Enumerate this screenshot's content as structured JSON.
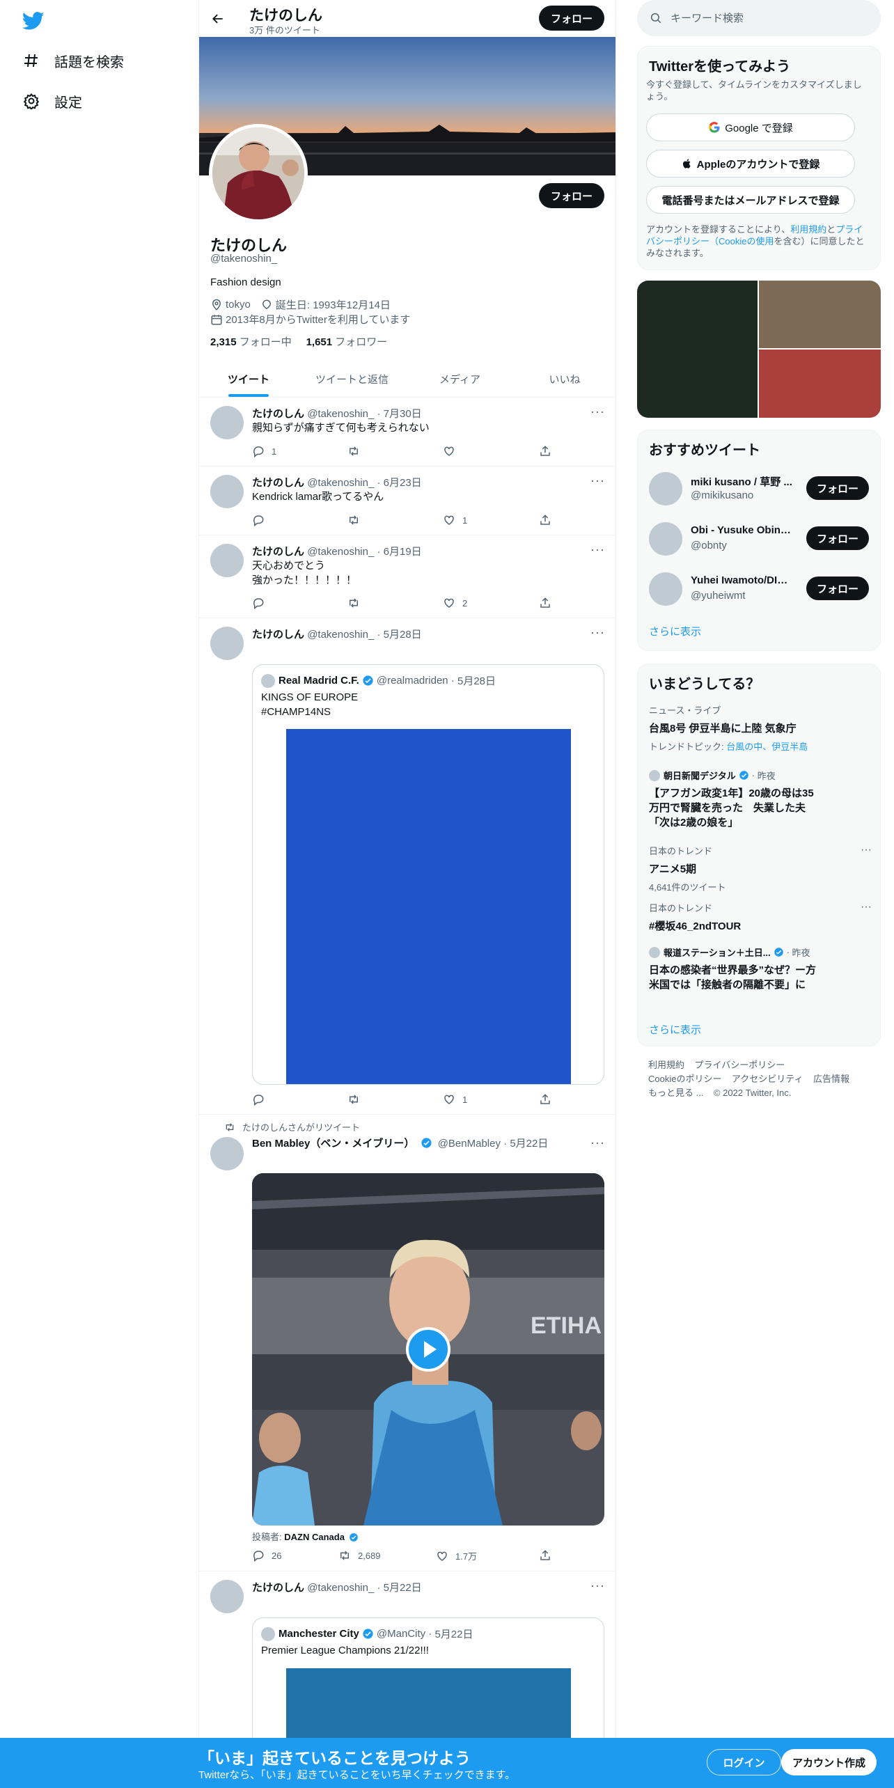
{
  "nav": {
    "items": [
      {
        "label": "話題を検索",
        "icon": "hashtag-icon"
      },
      {
        "label": "設定",
        "icon": "gear-icon"
      }
    ]
  },
  "header": {
    "name": "たけのしん",
    "tweet_count": "3万 件のツイート",
    "follow_label": "フォロー"
  },
  "profile": {
    "name": "たけのしん",
    "handle": "@takenoshin_",
    "bio": "Fashion design",
    "location": "tokyo",
    "birthday": "誕生日: 1993年12月14日",
    "joined": "2013年8月からTwitterを利用しています",
    "following_count": "2,315",
    "following_label": "フォロー中",
    "followers_count": "1,651",
    "followers_label": "フォロワー",
    "follow_label": "フォロー"
  },
  "tabs": [
    {
      "label": "ツイート",
      "active": true
    },
    {
      "label": "ツイートと返信",
      "active": false
    },
    {
      "label": "メディア",
      "active": false
    },
    {
      "label": "いいね",
      "active": false
    }
  ],
  "tweets": [
    {
      "name": "たけのしん",
      "handle": "@takenoshin_",
      "date": "7月30日",
      "text": "親知らずが痛すぎて何も考えられない",
      "replies": "1",
      "retweets": "",
      "likes": ""
    },
    {
      "name": "たけのしん",
      "handle": "@takenoshin_",
      "date": "6月23日",
      "text": "Kendrick lamar歌ってるやん",
      "replies": "",
      "retweets": "",
      "likes": "1"
    },
    {
      "name": "たけのしん",
      "handle": "@takenoshin_",
      "date": "6月19日",
      "text": "天心おめでとう\n強かった！！！！！！",
      "replies": "",
      "retweets": "",
      "likes": "2"
    },
    {
      "name": "たけのしん",
      "handle": "@takenoshin_",
      "date": "5月28日",
      "replies": "",
      "retweets": "",
      "likes": "1",
      "quote": {
        "name": "Real Madrid C.F.",
        "handle": "@realmadriden",
        "date": "5月28日",
        "text": "    KINGS OF EUROPE\n#CHAMP14NS"
      }
    },
    {
      "retweet_label": "たけのしんさんがリツイート",
      "name": "Ben Mabley（ベン・メイブリー）",
      "handle": "@BenMabley",
      "date": "5月22日",
      "source_prefix": "投稿者:",
      "source_name": "DAZN Canada",
      "replies": "26",
      "retweets": "2,689",
      "likes": "1.7万"
    },
    {
      "name": "たけのしん",
      "handle": "@takenoshin_",
      "date": "5月22日",
      "quote": {
        "name": "Manchester City",
        "handle": "@ManCity",
        "date": "5月22日",
        "text": "Premier League Champions 21/22!!!"
      }
    }
  ],
  "search": {
    "placeholder": "キーワード検索"
  },
  "signup_card": {
    "title": "Twitterを使ってみよう",
    "subtitle": "今すぐ登録して、タイムラインをカスタマイズしましょう。",
    "google": "Google で登録",
    "apple": "Appleのアカウントで登録",
    "phone": "電話番号またはメールアドレスで登録",
    "legal_1": "アカウントを登録することにより、",
    "legal_terms": "利用規約",
    "legal_2": "と",
    "legal_privacy": "プライバシーポリシー（Cookieの使用",
    "legal_3": "を含む）に同意したとみなされます。"
  },
  "recommend": {
    "title": "おすすめツイート",
    "users": [
      {
        "name": "miki kusano / 草野 ...",
        "handle": "@mikikusano"
      },
      {
        "name": "Obi - Yusuke Obinata",
        "handle": "@obnty"
      },
      {
        "name": "Yuhei Iwamoto/DIAM...",
        "handle": "@yuheiwmt"
      }
    ],
    "follow_label": "フォロー",
    "show_more": "さらに表示"
  },
  "trends": {
    "title": "いまどうしてる？",
    "items": [
      {
        "context": "ニュース・ライブ",
        "title": "台風8号 伊豆半島に上陸 気象庁",
        "sub_prefix": "トレンドトピック: ",
        "sub_links": "台風の中、伊豆半島"
      },
      {
        "source": "朝日新聞デジタル",
        "time": "昨夜",
        "title": "【アフガン政変1年】20歳の母は35万円で腎臓を売った　失業した夫「次は2歳の娘を」"
      },
      {
        "context": "日本のトレンド",
        "title": "アニメ5期",
        "count": "4,641件のツイート"
      },
      {
        "context": "日本のトレンド",
        "title": "#櫻坂46_2ndTOUR"
      },
      {
        "source": "報道ステーション＋土日...",
        "time": "昨夜",
        "title": "日本の感染者“世界最多”なぜ？ー方米国では「接触者の隔離不要」に"
      }
    ],
    "show_more": "さらに表示"
  },
  "footer": {
    "terms": "利用規約",
    "privacy": "プライバシーポリシー",
    "cookies": "Cookieのポリシー",
    "accessibility": "アクセシビリティ",
    "ads": "広告情報",
    "more": "もっと見る ...",
    "copyright": "© 2022 Twitter, Inc."
  },
  "bottom_bar": {
    "title": "「いま」起きていることを見つけよう",
    "subtitle": "Twitterなら、「いま」起きていることをいち早くチェックできます。",
    "login": "ログイン",
    "signup": "アカウント作成"
  },
  "colors": {
    "brand": "#1d9bf0",
    "text": "#0f1419",
    "muted": "#536471",
    "button_dark": "#0f1419"
  }
}
